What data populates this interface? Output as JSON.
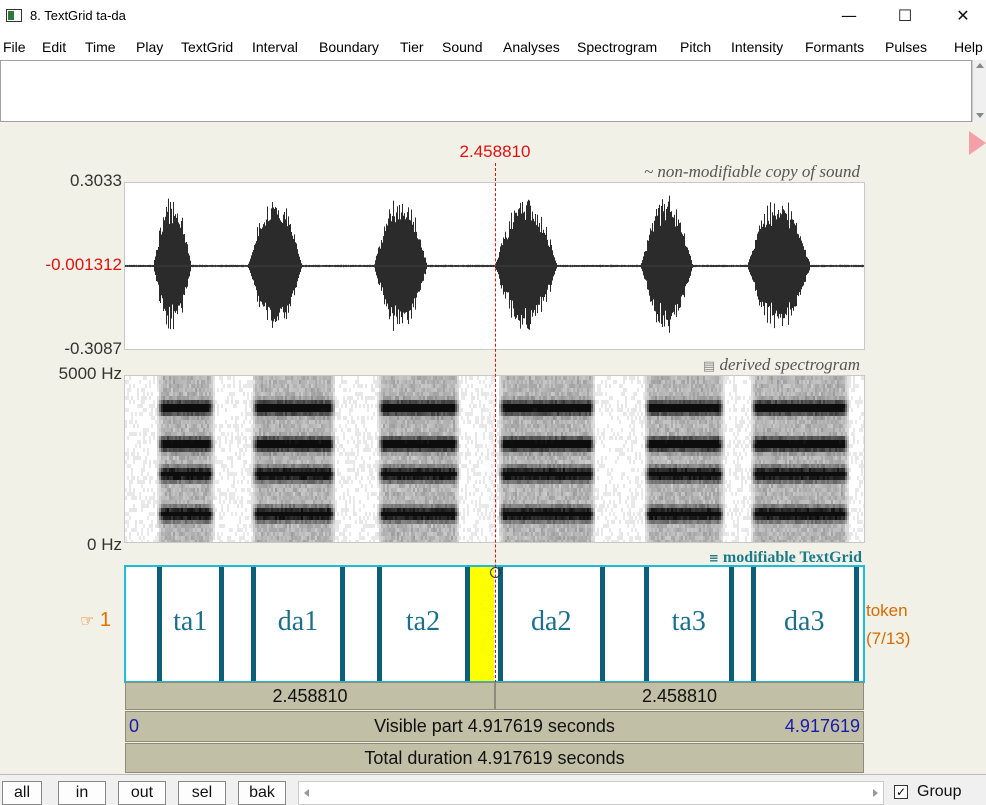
{
  "window": {
    "title": "8. TextGrid ta-da",
    "minimize": "—",
    "maximize": "☐",
    "close": "✕"
  },
  "menu": [
    "File",
    "Edit",
    "Time",
    "Play",
    "TextGrid",
    "Interval",
    "Boundary",
    "Tier",
    "Sound",
    "Analyses",
    "Spectrogram",
    "Pitch",
    "Intensity",
    "Formants",
    "Pulses",
    "Help"
  ],
  "cursor": {
    "time_label": "2.458810",
    "time_s": 2.45881
  },
  "sound": {
    "label": "~ non-modifiable copy of sound",
    "y_max": "0.3033",
    "y_cursor": "-0.001312",
    "y_min": "-0.3087",
    "y_max_value": 0.3033,
    "y_min_value": -0.3087,
    "y_cursor_value": -0.001312,
    "color": "#2b2b2b"
  },
  "spectrogram": {
    "label": "derived spectrogram",
    "f_max": "5000 Hz",
    "f_min": "0 Hz"
  },
  "textgrid": {
    "label": "modifiable TextGrid",
    "tier_number": "1",
    "tier_name": "token",
    "tier_count": "(7/13)",
    "intervals": [
      {
        "text": "ta1",
        "start": 0.226,
        "end": 0.642
      },
      {
        "text": "da1",
        "start": 0.855,
        "end": 1.447
      },
      {
        "text": "ta2",
        "start": 1.693,
        "end": 2.273
      },
      {
        "text": "da2",
        "start": 2.497,
        "end": 3.176
      },
      {
        "text": "ta3",
        "start": 3.468,
        "end": 4.035
      },
      {
        "text": "da3",
        "start": 4.176,
        "end": 4.864
      }
    ],
    "selected_interval": {
      "start": 2.273,
      "end": 2.458,
      "color": "#ffff00"
    }
  },
  "time_bars": {
    "left_part": "2.458810",
    "right_part": "2.458810",
    "visible_start": "0",
    "visible_text": "Visible part 4.917619 seconds",
    "visible_end": "4.917619",
    "total_text": "Total duration 4.917619 seconds",
    "duration_s": 4.917619
  },
  "bottom_buttons": [
    "all",
    "in",
    "out",
    "sel",
    "bak"
  ],
  "group": {
    "label": "Group",
    "checked": "✓"
  }
}
